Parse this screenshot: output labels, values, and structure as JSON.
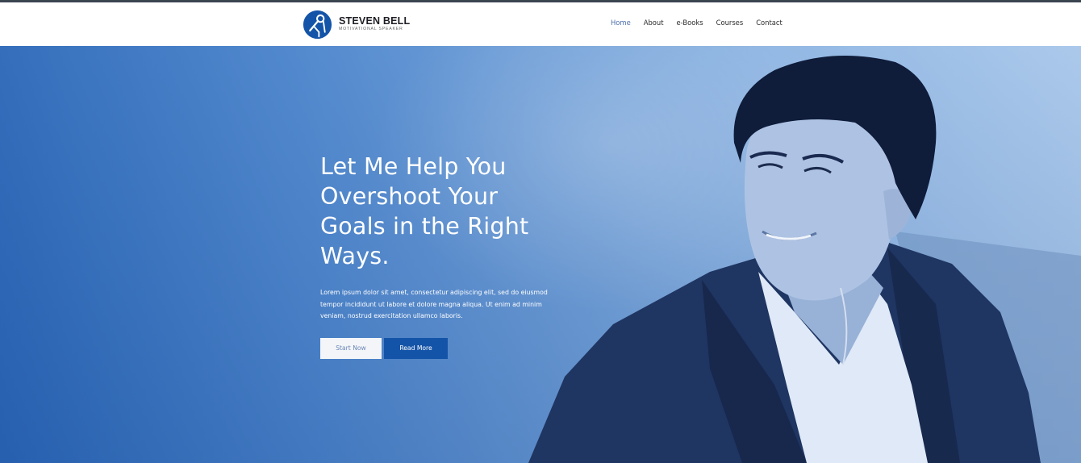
{
  "brand": {
    "name": "STEVEN BELL",
    "tagline": "MOTIVATIONAL SPEAKER"
  },
  "nav": {
    "items": [
      {
        "label": "Home",
        "active": true
      },
      {
        "label": "About",
        "active": false
      },
      {
        "label": "e-Books",
        "active": false
      },
      {
        "label": "Courses",
        "active": false
      },
      {
        "label": "Contact",
        "active": false
      }
    ]
  },
  "hero": {
    "title_lines": [
      "Let Me Help You",
      "Overshoot Your",
      "Goals in the Right",
      "Ways."
    ],
    "description_lines": [
      "Lorem ipsum dolor sit amet, consectetur adipiscing elit, sed do eiusmod",
      "tempor incididunt ut labore et dolore magna aliqua. Ut enim ad minim",
      "veniam, nostrud exercitation ullamco laboris."
    ],
    "start_button": "Start Now",
    "read_button": "Read More"
  },
  "colors": {
    "accent": "#1454a8",
    "hero_blue": "#2a67b8",
    "nav_active": "#4d6fae"
  },
  "icons": {
    "logo": "podium-speaker-icon"
  }
}
